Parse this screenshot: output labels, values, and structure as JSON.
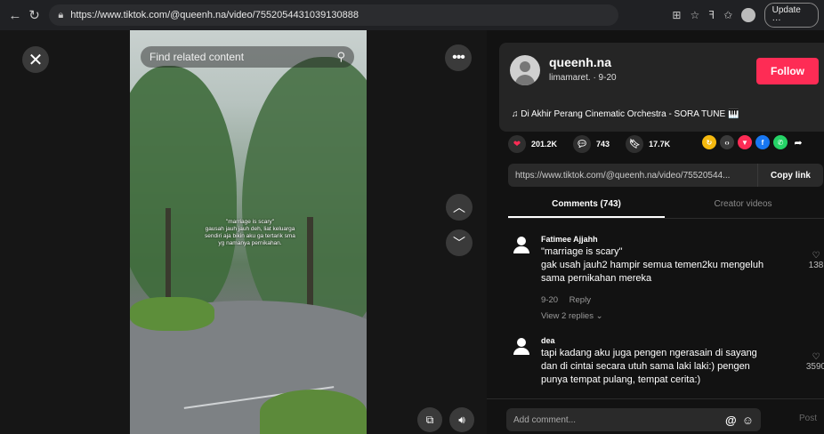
{
  "browser": {
    "url": "https://www.tiktok.com/@queenh.na/video/7552054431039130888",
    "update_label": "Update"
  },
  "video": {
    "search_placeholder": "Find related content",
    "caption": "\"marriage is scary\"\ngausah jauh jauh deh, liat keluarga\nsendiri aja bikin aku ga tertarik sma\nyg namanya pernikahan."
  },
  "author": {
    "username": "queenh.na",
    "subline": "limamaret. · 9-20",
    "follow_label": "Follow",
    "music": "♫  Di Akhir Perang Cinematic Orchestra - SORA TUNE 🎹"
  },
  "stats": {
    "likes": "201.2K",
    "comments": "743",
    "saves": "17.7K"
  },
  "share_colors": {
    "repost": "#f5b90f",
    "embed": "#3a3a3a",
    "send": "#fe2c55",
    "facebook": "#1877f2",
    "whatsapp": "#25d366"
  },
  "link": {
    "text": "https://www.tiktok.com/@queenh.na/video/75520544...",
    "copy_label": "Copy link"
  },
  "tabs": [
    {
      "label": "Comments (743)"
    },
    {
      "label": "Creator videos"
    }
  ],
  "comments": [
    {
      "name": "Fatimee Ajjahh",
      "text": "\"marriage is scary\"\ngak usah jauh2 hampir semua temen2ku mengeluh\nsama pernikahan mereka",
      "date": "9-20",
      "reply_label": "Reply",
      "replies_label": "View 2 replies ⌄",
      "likes": "138"
    },
    {
      "name": "dea",
      "text": "tapi kadang aku juga pengen ngerasain di sayang\ndan di cintai secara utuh sama laki laki:) pengen\npunya tempat pulang, tempat cerita:)",
      "likes": "3590"
    }
  ],
  "composer": {
    "placeholder": "Add comment...",
    "post_label": "Post"
  }
}
